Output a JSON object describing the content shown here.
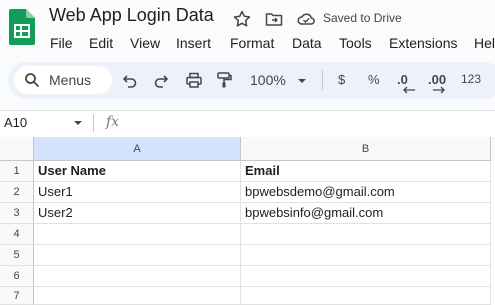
{
  "app": {
    "doc_title": "Web App Login Data",
    "saved_status": "Saved to Drive",
    "logo_color": "#0f9d58"
  },
  "menu": [
    "File",
    "Edit",
    "View",
    "Insert",
    "Format",
    "Data",
    "Tools",
    "Extensions",
    "Help"
  ],
  "toolbar": {
    "search_label": "Menus",
    "zoom": "100%",
    "currency": "$",
    "percent": "%",
    "decrease_decimal": ".0",
    "increase_decimal": ".00",
    "number_format": "123",
    "icons": [
      "search-icon",
      "undo-icon",
      "redo-icon",
      "print-icon",
      "paint-format-icon"
    ]
  },
  "formula_bar": {
    "name_box": "A10",
    "fx_label": "fx",
    "value": ""
  },
  "sheet": {
    "columns": [
      "A",
      "B"
    ],
    "selected_column": "A",
    "selection_color": "#d3e3fd",
    "rows": [
      {
        "num": "1",
        "A": "User Name",
        "B": "Email"
      },
      {
        "num": "2",
        "A": "User1",
        "B": "bpwebsdemo@gmail.com"
      },
      {
        "num": "3",
        "A": "User2",
        "B": "bpwebsinfo@gmail.com"
      },
      {
        "num": "4",
        "A": "",
        "B": ""
      },
      {
        "num": "5",
        "A": "",
        "B": ""
      },
      {
        "num": "6",
        "A": "",
        "B": ""
      },
      {
        "num": "7",
        "A": "",
        "B": ""
      }
    ]
  }
}
